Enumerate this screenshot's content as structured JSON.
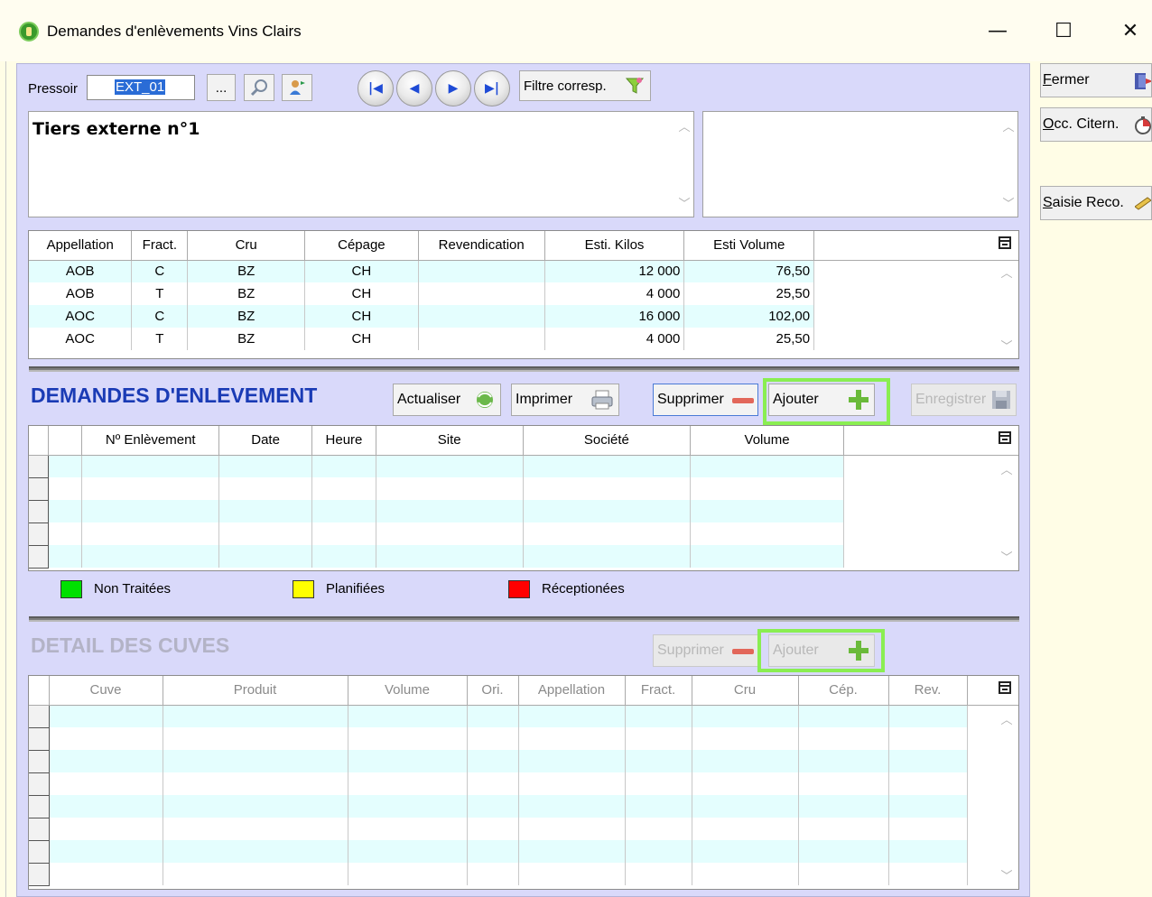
{
  "window": {
    "title": "Demandes d'enlèvements Vins Clairs",
    "controls": {
      "minimize": "—",
      "maximize": "☐",
      "close": "✕"
    }
  },
  "header": {
    "pressoir_label": "Pressoir",
    "pressoir_value": "EXT_01",
    "browse_label": "...",
    "filter_button_label": "Filtre corresp.",
    "tiers_text": "Tiers externe n°1"
  },
  "appellation_grid": {
    "columns": [
      "Appellation",
      "Fract.",
      "Cru",
      "Cépage",
      "Revendication",
      "Esti. Kilos",
      "Esti Volume"
    ],
    "rows": [
      [
        "AOB",
        "C",
        "BZ",
        "CH",
        "",
        "12 000",
        "76,50"
      ],
      [
        "AOB",
        "T",
        "BZ",
        "CH",
        "",
        "4 000",
        "25,50"
      ],
      [
        "AOC",
        "C",
        "BZ",
        "CH",
        "",
        "16 000",
        "102,00"
      ],
      [
        "AOC",
        "T",
        "BZ",
        "CH",
        "",
        "4 000",
        "25,50"
      ]
    ]
  },
  "demandes": {
    "title": "DEMANDES D'ENLEVEMENT",
    "actualiser_label": "Actualiser",
    "imprimer_label": "Imprimer",
    "supprimer_label": "Supprimer",
    "ajouter_label": "Ajouter",
    "enregistrer_label": "Enregistrer",
    "columns": [
      "Nº Enlèvement",
      "Date",
      "Heure",
      "Site",
      "Société",
      "Volume"
    ],
    "rows": [
      [
        "",
        "",
        "",
        "",
        "",
        ""
      ],
      [
        "",
        "",
        "",
        "",
        "",
        ""
      ],
      [
        "",
        "",
        "",
        "",
        "",
        ""
      ],
      [
        "",
        "",
        "",
        "",
        "",
        ""
      ],
      [
        "",
        "",
        "",
        "",
        "",
        ""
      ]
    ]
  },
  "legend": [
    {
      "label": "Non Traitées",
      "color": "#00e000"
    },
    {
      "label": "Planifiées",
      "color": "#ffff00"
    },
    {
      "label": "Réceptionées",
      "color": "#ff0000"
    }
  ],
  "detail": {
    "title": "DETAIL DES CUVES",
    "supprimer_label": "Supprimer",
    "ajouter_label": "Ajouter",
    "columns": [
      "Cuve",
      "Produit",
      "Volume",
      "Ori.",
      "Appellation",
      "Fract.",
      "Cru",
      "Cép.",
      "Rev."
    ],
    "rows": [
      [
        "",
        "",
        "",
        "",
        "",
        "",
        "",
        "",
        ""
      ],
      [
        "",
        "",
        "",
        "",
        "",
        "",
        "",
        "",
        ""
      ],
      [
        "",
        "",
        "",
        "",
        "",
        "",
        "",
        "",
        ""
      ],
      [
        "",
        "",
        "",
        "",
        "",
        "",
        "",
        "",
        ""
      ],
      [
        "",
        "",
        "",
        "",
        "",
        "",
        "",
        "",
        ""
      ],
      [
        "",
        "",
        "",
        "",
        "",
        "",
        "",
        "",
        ""
      ],
      [
        "",
        "",
        "",
        "",
        "",
        "",
        "",
        "",
        ""
      ],
      [
        "",
        "",
        "",
        "",
        "",
        "",
        "",
        "",
        ""
      ]
    ]
  },
  "sidebar": {
    "fermer_rest": "ermer",
    "fermer_key": "F",
    "occ_rest": "cc. Citern.",
    "occ_key": "O",
    "saisie_rest": "aisie Reco.",
    "saisie_key": "S"
  },
  "colors": {
    "panel_bg": "#d9d9fa",
    "outer_bg": "#fffde6",
    "title_blue": "#1a3bb5",
    "title_disabled": "#b3b3c6",
    "row_alt": "#e4fefe",
    "highlight": "#8aee52",
    "selection": "#2a6cd6"
  }
}
